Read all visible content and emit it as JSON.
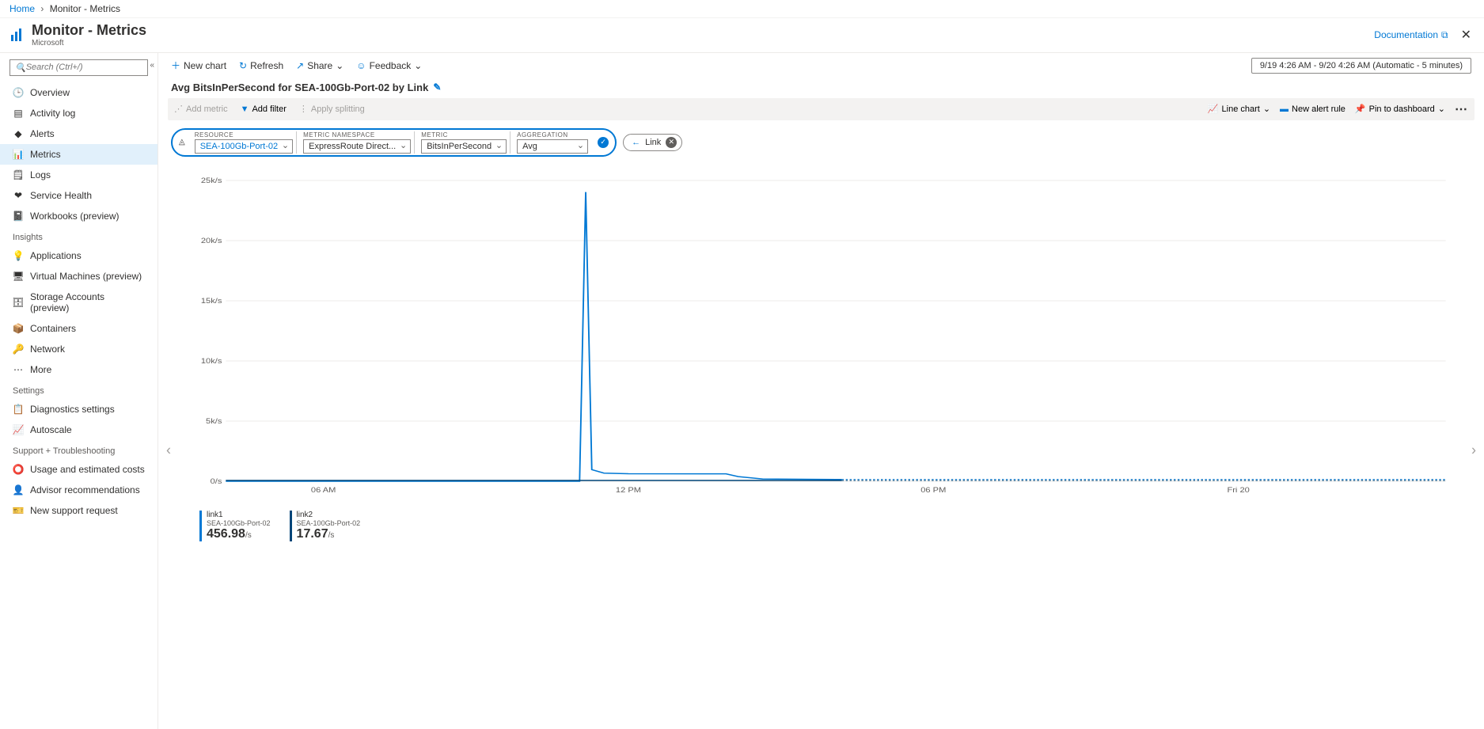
{
  "breadcrumb": {
    "home": "Home",
    "current": "Monitor - Metrics"
  },
  "header": {
    "title": "Monitor - Metrics",
    "subtitle": "Microsoft",
    "documentation": "Documentation"
  },
  "search": {
    "placeholder": "Search (Ctrl+/)"
  },
  "nav": {
    "items": [
      {
        "label": "Overview",
        "icon": "🕒"
      },
      {
        "label": "Activity log",
        "icon": "▤"
      },
      {
        "label": "Alerts",
        "icon": "◆"
      },
      {
        "label": "Metrics",
        "icon": "📊",
        "active": true
      },
      {
        "label": "Logs",
        "icon": "🗒"
      },
      {
        "label": "Service Health",
        "icon": "❤"
      },
      {
        "label": "Workbooks (preview)",
        "icon": "📓"
      }
    ],
    "insights_label": "Insights",
    "insights": [
      {
        "label": "Applications",
        "icon": "💡"
      },
      {
        "label": "Virtual Machines (preview)",
        "icon": "🖥"
      },
      {
        "label": "Storage Accounts (preview)",
        "icon": "🗄"
      },
      {
        "label": "Containers",
        "icon": "📦"
      },
      {
        "label": "Network",
        "icon": "🔑"
      },
      {
        "label": "More",
        "icon": "⋯"
      }
    ],
    "settings_label": "Settings",
    "settings": [
      {
        "label": "Diagnostics settings",
        "icon": "📋"
      },
      {
        "label": "Autoscale",
        "icon": "📈"
      }
    ],
    "support_label": "Support + Troubleshooting",
    "support": [
      {
        "label": "Usage and estimated costs",
        "icon": "⭕"
      },
      {
        "label": "Advisor recommendations",
        "icon": "👤"
      },
      {
        "label": "New support request",
        "icon": "🎫"
      }
    ]
  },
  "toolbar": {
    "new_chart": "New chart",
    "refresh": "Refresh",
    "share": "Share",
    "feedback": "Feedback",
    "time_range": "9/19 4:26 AM - 9/20 4:26 AM (Automatic - 5 minutes)"
  },
  "chart": {
    "title": "Avg BitsInPerSecond for SEA-100Gb-Port-02 by Link"
  },
  "filterbar": {
    "add_metric": "Add metric",
    "add_filter": "Add filter",
    "apply_splitting": "Apply splitting",
    "line_chart": "Line chart",
    "new_alert": "New alert rule",
    "pin": "Pin to dashboard"
  },
  "selectors": {
    "resource_label": "RESOURCE",
    "resource_value": "SEA-100Gb-Port-02",
    "namespace_label": "METRIC NAMESPACE",
    "namespace_value": "ExpressRoute Direct...",
    "metric_label": "METRIC",
    "metric_value": "BitsInPerSecond",
    "agg_label": "AGGREGATION",
    "agg_value": "Avg",
    "link_tag": "Link"
  },
  "chart_data": {
    "type": "line",
    "ylabel": "",
    "ylim": [
      0,
      26000
    ],
    "y_ticks": [
      "0/s",
      "5k/s",
      "10k/s",
      "15k/s",
      "20k/s",
      "25k/s"
    ],
    "x_ticks": [
      "06 AM",
      "12 PM",
      "06 PM",
      "Fri 20"
    ],
    "series": [
      {
        "name": "link1",
        "resource": "SEA-100Gb-Port-02",
        "summary_value": "456.98",
        "unit": "/s"
      },
      {
        "name": "link2",
        "resource": "SEA-100Gb-Port-02",
        "summary_value": "17.67",
        "unit": "/s"
      }
    ],
    "data_points": {
      "x": [
        0,
        0.29,
        0.295,
        0.3,
        0.31,
        0.33,
        0.41,
        0.42,
        0.44,
        0.5,
        0.505
      ],
      "y": [
        0,
        0,
        25000,
        1000,
        700,
        650,
        640,
        400,
        200,
        150,
        150
      ]
    },
    "dashed_from_x": 0.505
  },
  "legend": {
    "items": [
      {
        "name": "link1",
        "sub": "SEA-100Gb-Port-02",
        "value": "456.98",
        "unit": "/s"
      },
      {
        "name": "link2",
        "sub": "SEA-100Gb-Port-02",
        "value": "17.67",
        "unit": "/s"
      }
    ]
  }
}
